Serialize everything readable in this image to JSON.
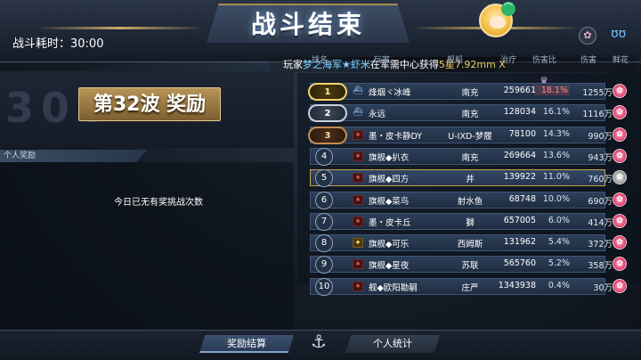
{
  "header": {
    "title": "战斗结束",
    "battle_time": "战斗耗时：30:00",
    "broadcast": {
      "prefix": "玩家",
      "player": "梦之海军★虾米",
      "middle": "在军需中心获得",
      "item": "5星7.92mm X"
    }
  },
  "left_panel": {
    "wave_title": "第32波 奖励",
    "wave_deco": "306",
    "personal_header": "个人奖励",
    "no_reward_text": "今日已无有奖挑战次数"
  },
  "table": {
    "columns": [
      "排名",
      "玩家",
      "舰船",
      "治疗",
      "伤害比",
      "伤害",
      "鲜花"
    ],
    "rows": [
      {
        "rank": "1",
        "name": "烽烟ヾ冰峰",
        "ship": "南充",
        "repair": "259661",
        "ratio": "18.1%",
        "damage": "1255万",
        "icon": "ship",
        "badge": "gold"
      },
      {
        "rank": "2",
        "name": "永远",
        "ship": "南充",
        "repair": "128034",
        "ratio": "16.1%",
        "damage": "1116万",
        "icon": "ship",
        "badge": "silver"
      },
      {
        "rank": "3",
        "name": "墨・皮卡静DY",
        "ship": "U-IXD-梦履",
        "repair": "78100",
        "ratio": "14.3%",
        "damage": "990万",
        "icon": "flag",
        "badge": "bronze"
      },
      {
        "rank": "4",
        "name": "旗舰◆扒衣",
        "ship": "南充",
        "repair": "269664",
        "ratio": "13.6%",
        "damage": "943万",
        "icon": "flag",
        "badge": "plain"
      },
      {
        "rank": "5",
        "name": "旗舰◆四方",
        "ship": "井",
        "repair": "139922",
        "ratio": "11.0%",
        "damage": "760万",
        "icon": "flag",
        "badge": "plain"
      },
      {
        "rank": "6",
        "name": "旗舰◆菜鸟",
        "ship": "射水鱼",
        "repair": "68748",
        "ratio": "10.0%",
        "damage": "690万",
        "icon": "flag",
        "badge": "plain"
      },
      {
        "rank": "7",
        "name": "墨・皮卡丘",
        "ship": "獅",
        "repair": "657005",
        "ratio": "6.0%",
        "damage": "414万",
        "icon": "flag",
        "badge": "plain"
      },
      {
        "rank": "8",
        "name": "旗舰◆可乐",
        "ship": "西姆斯",
        "repair": "131962",
        "ratio": "5.4%",
        "damage": "372万",
        "icon": "yellow",
        "badge": "plain"
      },
      {
        "rank": "9",
        "name": "旗舰◆星夜",
        "ship": "苏联",
        "repair": "565760",
        "ratio": "5.2%",
        "damage": "358万",
        "icon": "flag",
        "badge": "plain"
      },
      {
        "rank": "10",
        "name": "舰◆欧阳勘嗣",
        "ship": "庄严",
        "repair": "1343938",
        "ratio": "0.4%",
        "damage": "30万",
        "icon": "flag",
        "badge": "plain"
      }
    ]
  },
  "bottom": {
    "tab_reward": "奖励结算",
    "tab_stats": "个人统计"
  },
  "icons": {
    "avatar": "avatar-icon",
    "wifi": "wifi-icon",
    "flower": "flower-icon",
    "share": "share-icon"
  }
}
